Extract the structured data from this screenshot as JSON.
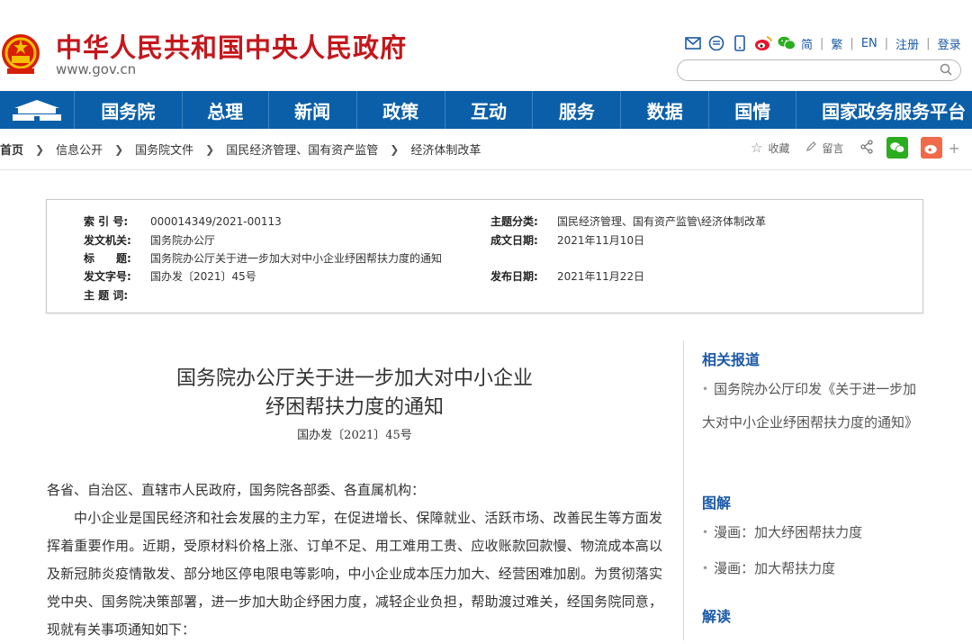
{
  "header": {
    "site_title": "中华人民共和国中央人民政府",
    "site_url": "www.gov.cn",
    "links": [
      "简",
      "繁",
      "EN",
      "注册",
      "登录"
    ],
    "icons": [
      "mail-icon",
      "chat-bubble-icon",
      "mobile-icon",
      "weibo-icon",
      "wechat-icon"
    ]
  },
  "nav": {
    "items": [
      "国务院",
      "总理",
      "新闻",
      "政策",
      "互动",
      "服务",
      "数据",
      "国情",
      "国家政务服务平台"
    ]
  },
  "breadcrumb": [
    "首页",
    "信息公开",
    "国务院文件",
    "国民经济管理、国有资产监管",
    "经济体制改革"
  ],
  "share": {
    "favorite": "收藏",
    "comment": "留言",
    "more": "+"
  },
  "info": {
    "index_label": "索 引 号:",
    "index_value": "000014349/2021-00113",
    "issuer_label": "发文机关:",
    "issuer_value": "国务院办公厅",
    "title_label": "标　　题:",
    "title_value": "国务院办公厅关于进一步加大对中小企业纾困帮扶力度的通知",
    "docno_label": "发文字号:",
    "docno_value": "国办发〔2021〕45号",
    "keywords_label": "主 题 词:",
    "topic_label": "主题分类:",
    "topic_value": "国民经济管理、国有资产监管\\经济体制改革",
    "date_label": "成文日期:",
    "date_value": "2021年11月10日",
    "publish_label": "发布日期:",
    "publish_value": "2021年11月22日"
  },
  "article": {
    "title_line1": "国务院办公厅关于进一步加大对中小企业",
    "title_line2": "纾困帮扶力度的通知",
    "doc_number": "国办发〔2021〕45号",
    "salutation": "各省、自治区、直辖市人民政府，国务院各部委、各直属机构：",
    "para1": "中小企业是国民经济和社会发展的主力军，在促进增长、保障就业、活跃市场、改善民生等方面发挥着重要作用。近期，受原材料价格上涨、订单不足、用工难用工贵、应收账款回款慢、物流成本高以及新冠肺炎疫情散发、部分地区停电限电等影响，中小企业成本压力加大、经营困难加剧。为贯彻落实党中央、国务院决策部署，进一步加大助企纾困力度，减轻企业负担，帮助渡过难关，经国务院同意，现就有关事项通知如下："
  },
  "sidebar": {
    "related_head": "相关报道",
    "related_item": "国务院办公厅印发《关于进一步加大对中小企业纾困帮扶力度的通知》",
    "graphics_head": "图解",
    "graphics_items": [
      "漫画：加大纾困帮扶力度",
      "漫画：加大帮扶力度"
    ],
    "interpret_head": "解读"
  },
  "colors": {
    "brand_red": "#c4171c",
    "nav_blue": "#0b5fa8",
    "link_blue": "#1c5aa6"
  }
}
